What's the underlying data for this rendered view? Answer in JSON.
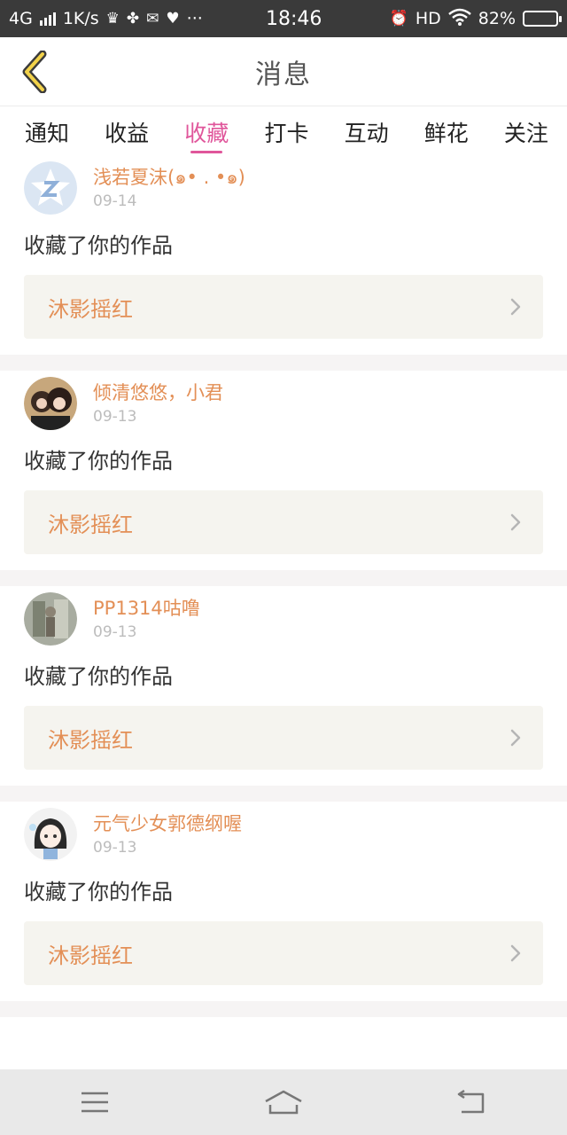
{
  "status_bar": {
    "network": "4G",
    "speed": "1K/s",
    "time": "18:46",
    "hd": "HD",
    "battery": "82%",
    "battery_level": 0.82,
    "more": "···"
  },
  "header": {
    "title": "消息",
    "back_icon": "chevron-left-icon",
    "accent_color": "#e0569b",
    "name_color": "#e38f56"
  },
  "tabs": [
    {
      "label": "通知"
    },
    {
      "label": "收益"
    },
    {
      "label": "收藏",
      "active": true
    },
    {
      "label": "打卡"
    },
    {
      "label": "互动"
    },
    {
      "label": "鲜花"
    },
    {
      "label": "关注"
    }
  ],
  "feed": [
    {
      "user": "浅若夏沫(๑• . •๑)",
      "date": "09-14",
      "action": "收藏了你的作品",
      "work": "沐影摇红"
    },
    {
      "user": "倾清悠悠，小君",
      "date": "09-13",
      "action": "收藏了你的作品",
      "work": "沐影摇红"
    },
    {
      "user": "PP1314咕噜",
      "date": "09-13",
      "action": "收藏了你的作品",
      "work": "沐影摇红"
    },
    {
      "user": "元气少女郭德纲喔",
      "date": "09-13",
      "action": "收藏了你的作品",
      "work": "沐影摇红"
    }
  ],
  "nav_bar": {
    "menu_icon": "menu-icon",
    "home_icon": "home-icon",
    "back_icon": "back-arrow-icon"
  }
}
